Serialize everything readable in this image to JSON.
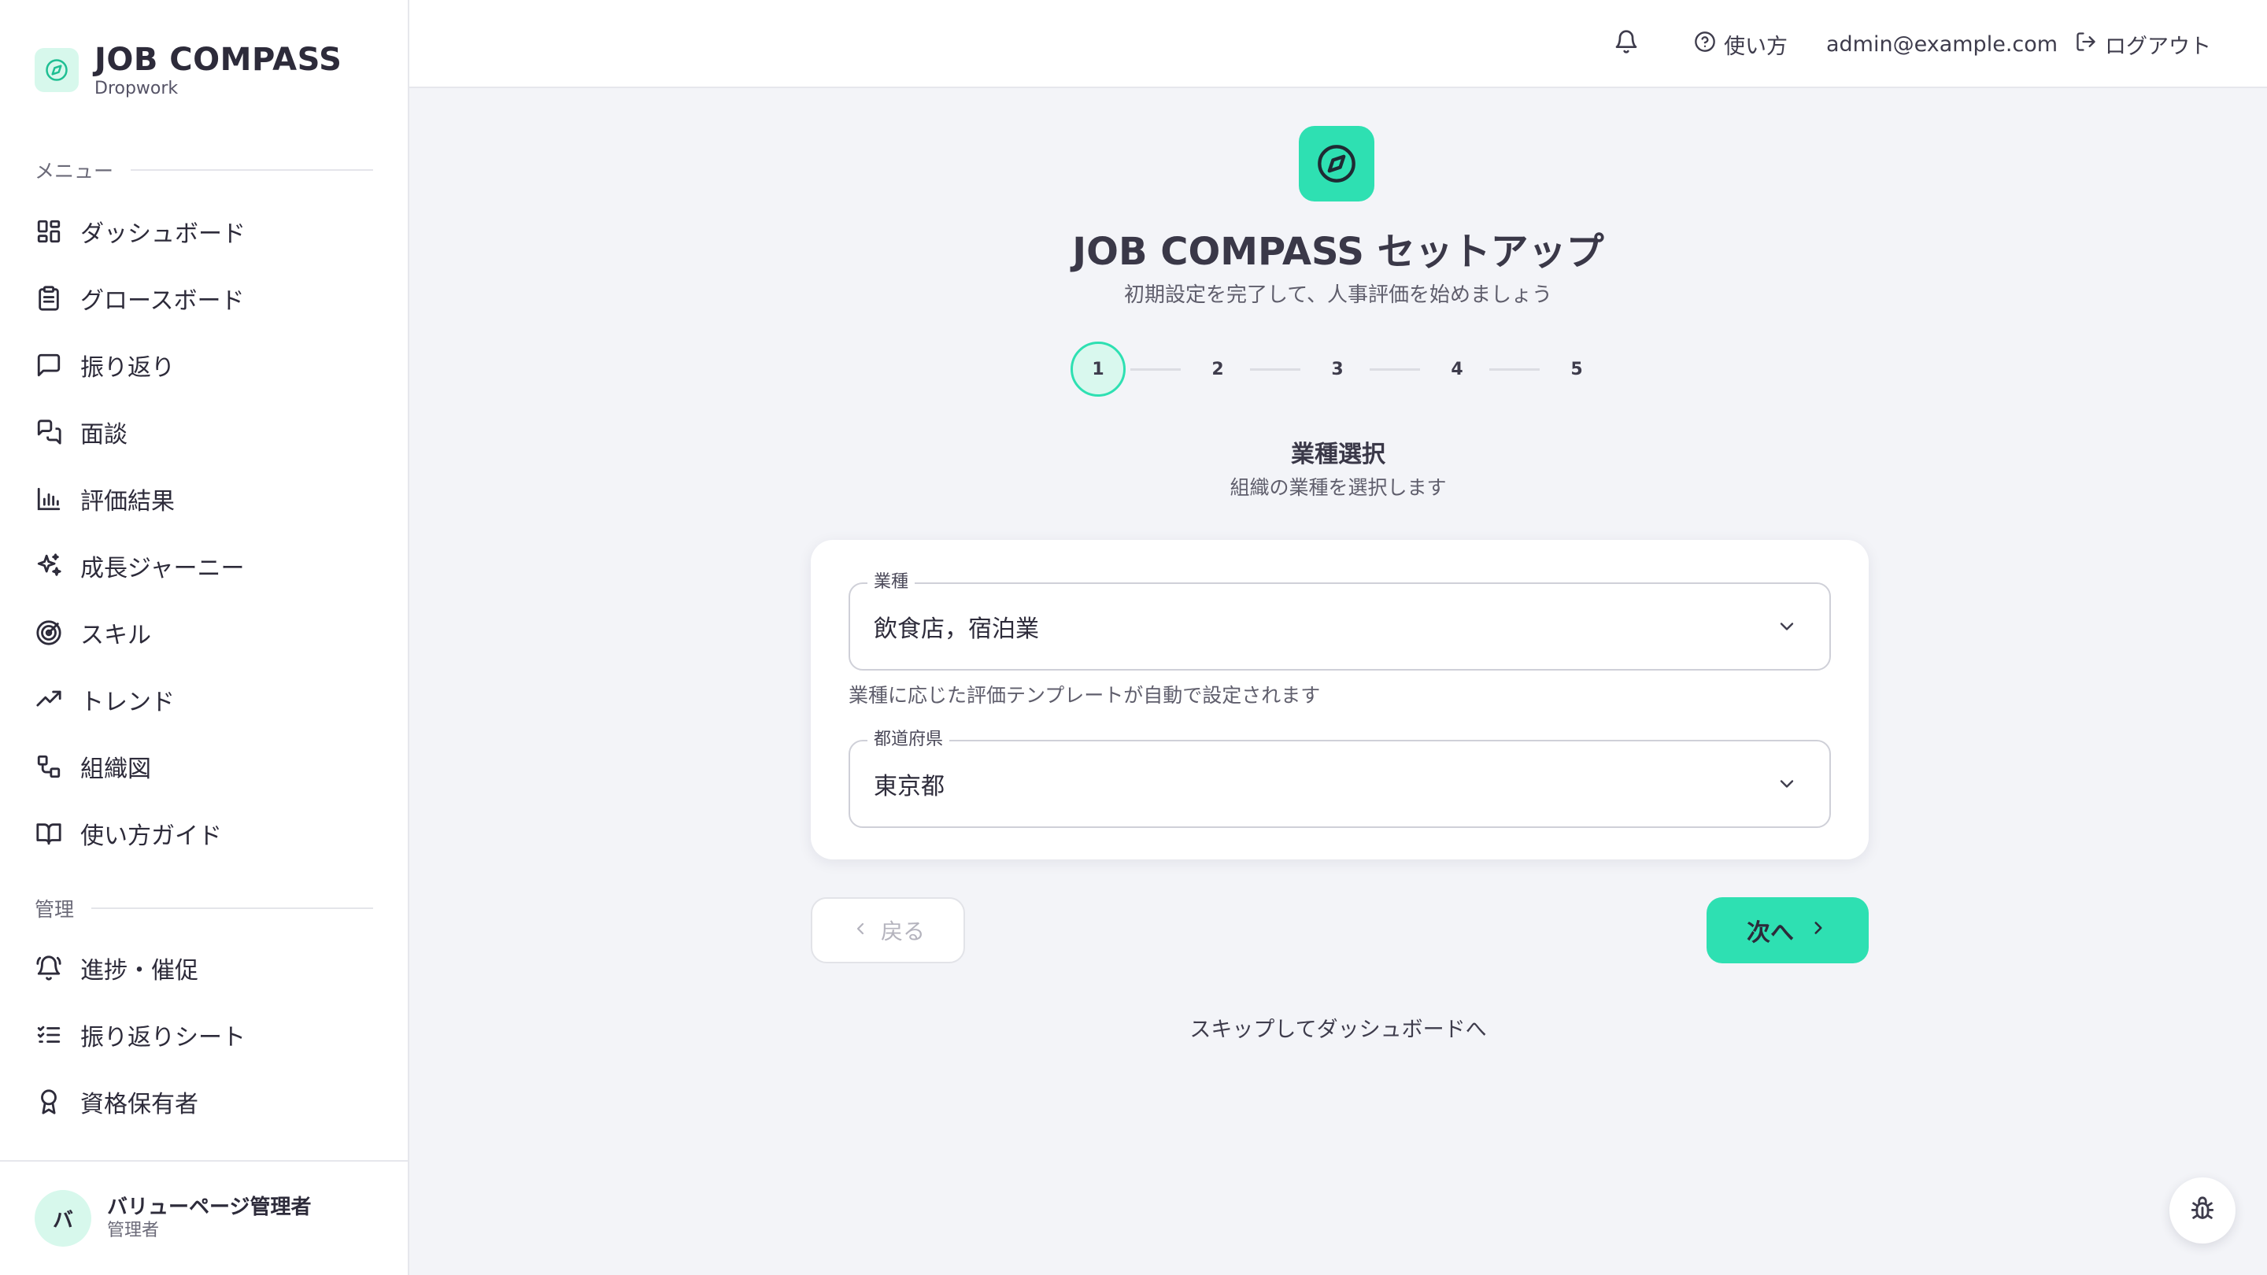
{
  "brand": {
    "title": "JOB COMPASS",
    "subtitle": "Dropwork"
  },
  "sidebar": {
    "menu_label": "メニュー",
    "menu_items": [
      {
        "label": "ダッシュボード",
        "icon": "dashboard-grid-icon"
      },
      {
        "label": "グロースボード",
        "icon": "clipboard-icon"
      },
      {
        "label": "振り返り",
        "icon": "message-square-icon"
      },
      {
        "label": "面談",
        "icon": "chat-bubbles-icon"
      },
      {
        "label": "評価結果",
        "icon": "bar-chart-icon"
      },
      {
        "label": "成長ジャーニー",
        "icon": "sparkles-icon"
      },
      {
        "label": "スキル",
        "icon": "target-icon"
      },
      {
        "label": "トレンド",
        "icon": "trending-up-icon"
      },
      {
        "label": "組織図",
        "icon": "org-chart-icon"
      },
      {
        "label": "使い方ガイド",
        "icon": "book-open-icon"
      }
    ],
    "admin_label": "管理",
    "admin_items": [
      {
        "label": "進捗・催促",
        "icon": "bell-ring-icon"
      },
      {
        "label": "振り返りシート",
        "icon": "list-checks-icon"
      },
      {
        "label": "資格保有者",
        "icon": "award-icon"
      }
    ]
  },
  "user": {
    "initial": "バ",
    "name": "バリューページ管理者",
    "role": "管理者"
  },
  "header": {
    "help_label": "使い方",
    "email": "admin@example.com",
    "logout_label": "ログアウト"
  },
  "setup": {
    "title": "JOB COMPASS セットアップ",
    "subtitle": "初期設定を完了して、人事評価を始めましょう",
    "steps": [
      "1",
      "2",
      "3",
      "4",
      "5"
    ],
    "current_step": 1,
    "step_title": "業種選択",
    "step_subtitle": "組織の業種を選択します",
    "industry": {
      "label": "業種",
      "value": "飲食店，宿泊業"
    },
    "industry_helper": "業種に応じた評価テンプレートが自動で設定されます",
    "prefecture": {
      "label": "都道府県",
      "value": "東京都"
    },
    "back_label": "戻る",
    "next_label": "次へ",
    "skip_label": "スキップしてダッシュボードへ"
  },
  "colors": {
    "accent": "#2ee0b2",
    "accent_soft": "#d7f8ec",
    "background": "#f3f4f8"
  }
}
